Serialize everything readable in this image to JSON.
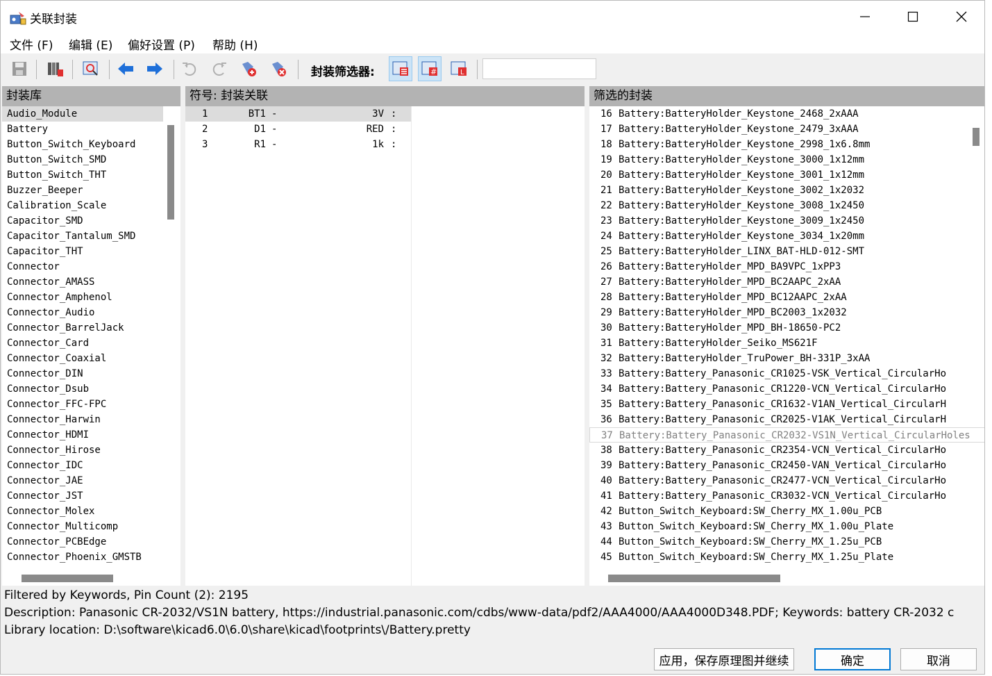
{
  "window": {
    "title": "关联封装"
  },
  "menu": [
    "文件 (F)",
    "编辑 (E)",
    "偏好设置 (P)",
    "帮助 (H)"
  ],
  "toolbar": {
    "filter_label": "封装筛选器:",
    "filter_value": ""
  },
  "libraries": {
    "header": "封装库",
    "selected": "Audio_Module",
    "items": [
      "Audio_Module",
      "Battery",
      "Button_Switch_Keyboard",
      "Button_Switch_SMD",
      "Button_Switch_THT",
      "Buzzer_Beeper",
      "Calibration_Scale",
      "Capacitor_SMD",
      "Capacitor_Tantalum_SMD",
      "Capacitor_THT",
      "Connector",
      "Connector_AMASS",
      "Connector_Amphenol",
      "Connector_Audio",
      "Connector_BarrelJack",
      "Connector_Card",
      "Connector_Coaxial",
      "Connector_DIN",
      "Connector_Dsub",
      "Connector_FFC-FPC",
      "Connector_Harwin",
      "Connector_HDMI",
      "Connector_Hirose",
      "Connector_IDC",
      "Connector_JAE",
      "Connector_JST",
      "Connector_Molex",
      "Connector_Multicomp",
      "Connector_PCBEdge",
      "Connector_Phoenix_GMSTB"
    ]
  },
  "symbols": {
    "header": "符号: 封装关联",
    "rows": [
      {
        "num": "1",
        "ref": "BT1",
        "dash": "-",
        "value": "3V",
        "colon": ":"
      },
      {
        "num": "2",
        "ref": "D1",
        "dash": "-",
        "value": "RED",
        "colon": ":"
      },
      {
        "num": "3",
        "ref": "R1",
        "dash": "-",
        "value": "1k",
        "colon": ":"
      }
    ]
  },
  "footprints": {
    "header": "筛选的封装",
    "rows": [
      {
        "num": "16",
        "name": "Battery:BatteryHolder_Keystone_2468_2xAAA"
      },
      {
        "num": "17",
        "name": "Battery:BatteryHolder_Keystone_2479_3xAAA"
      },
      {
        "num": "18",
        "name": "Battery:BatteryHolder_Keystone_2998_1x6.8mm"
      },
      {
        "num": "19",
        "name": "Battery:BatteryHolder_Keystone_3000_1x12mm"
      },
      {
        "num": "20",
        "name": "Battery:BatteryHolder_Keystone_3001_1x12mm"
      },
      {
        "num": "21",
        "name": "Battery:BatteryHolder_Keystone_3002_1x2032"
      },
      {
        "num": "22",
        "name": "Battery:BatteryHolder_Keystone_3008_1x2450"
      },
      {
        "num": "23",
        "name": "Battery:BatteryHolder_Keystone_3009_1x2450"
      },
      {
        "num": "24",
        "name": "Battery:BatteryHolder_Keystone_3034_1x20mm"
      },
      {
        "num": "25",
        "name": "Battery:BatteryHolder_LINX_BAT-HLD-012-SMT"
      },
      {
        "num": "26",
        "name": "Battery:BatteryHolder_MPD_BA9VPC_1xPP3"
      },
      {
        "num": "27",
        "name": "Battery:BatteryHolder_MPD_BC2AAPC_2xAA"
      },
      {
        "num": "28",
        "name": "Battery:BatteryHolder_MPD_BC12AAPC_2xAA"
      },
      {
        "num": "29",
        "name": "Battery:BatteryHolder_MPD_BC2003_1x2032"
      },
      {
        "num": "30",
        "name": "Battery:BatteryHolder_MPD_BH-18650-PC2"
      },
      {
        "num": "31",
        "name": "Battery:BatteryHolder_Seiko_MS621F"
      },
      {
        "num": "32",
        "name": "Battery:BatteryHolder_TruPower_BH-331P_3xAA"
      },
      {
        "num": "33",
        "name": "Battery:Battery_Panasonic_CR1025-VSK_Vertical_CircularHo"
      },
      {
        "num": "34",
        "name": "Battery:Battery_Panasonic_CR1220-VCN_Vertical_CircularHo"
      },
      {
        "num": "35",
        "name": "Battery:Battery_Panasonic_CR1632-V1AN_Vertical_CircularH"
      },
      {
        "num": "36",
        "name": "Battery:Battery_Panasonic_CR2025-V1AK_Vertical_CircularH"
      },
      {
        "num": "37",
        "name": "Battery:Battery_Panasonic_CR2032-VS1N_Vertical_CircularHoles"
      },
      {
        "num": "38",
        "name": "Battery:Battery_Panasonic_CR2354-VCN_Vertical_CircularHo"
      },
      {
        "num": "39",
        "name": "Battery:Battery_Panasonic_CR2450-VAN_Vertical_CircularHo"
      },
      {
        "num": "40",
        "name": "Battery:Battery_Panasonic_CR2477-VCN_Vertical_CircularHo"
      },
      {
        "num": "41",
        "name": "Battery:Battery_Panasonic_CR3032-VCN_Vertical_CircularHo"
      },
      {
        "num": "42",
        "name": "Button_Switch_Keyboard:SW_Cherry_MX_1.00u_PCB"
      },
      {
        "num": "43",
        "name": "Button_Switch_Keyboard:SW_Cherry_MX_1.00u_Plate"
      },
      {
        "num": "44",
        "name": "Button_Switch_Keyboard:SW_Cherry_MX_1.25u_PCB"
      },
      {
        "num": "45",
        "name": "Button_Switch_Keyboard:SW_Cherry_MX_1.25u_Plate"
      }
    ],
    "selected_index": 21
  },
  "status": {
    "line1": "Filtered by Keywords, Pin Count (2): 2195",
    "line2": "Description: Panasonic CR-2032/VS1N battery, https://industrial.panasonic.com/cdbs/www-data/pdf2/AAA4000/AAA4000D348.PDF;  Keywords: battery CR-2032 c",
    "line3": "Library location: D:\\software\\kicad6.0\\6.0\\share\\kicad\\footprints\\/Battery.pretty"
  },
  "buttons": {
    "apply": "应用，保存原理图并继续",
    "ok": "确定",
    "cancel": "取消"
  },
  "colors": {
    "accent": "#0078d4",
    "header_bg": "#b3b3b3",
    "selected_row": "#dcdcdc",
    "arrow_blue": "#1e6fd9",
    "icon_red": "#e03030"
  }
}
